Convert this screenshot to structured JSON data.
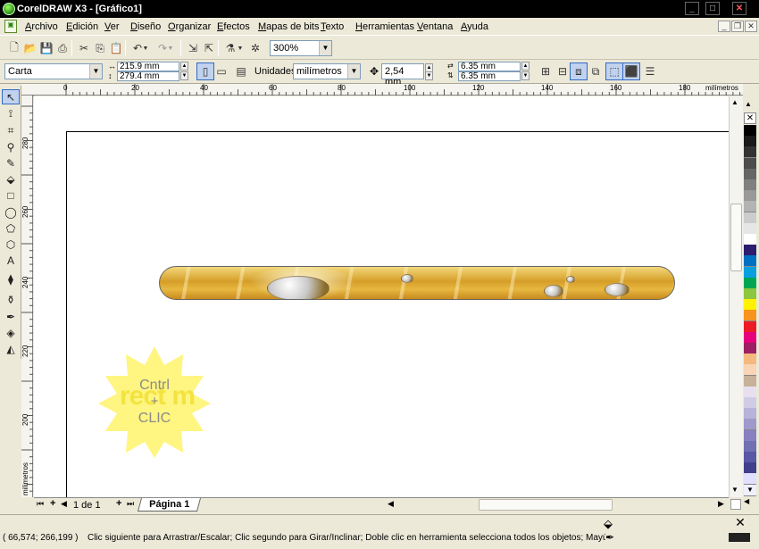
{
  "window": {
    "title": "CorelDRAW X3 - [Gráfico1]"
  },
  "menu": [
    "Archivo",
    "Edición",
    "Ver",
    "Diseño",
    "Organizar",
    "Efectos",
    "Mapas de bits",
    "Texto",
    "Herramientas",
    "Ventana",
    "Ayuda"
  ],
  "toolbar": {
    "zoom": "300%"
  },
  "property_bar": {
    "paper": "Carta",
    "width": "215.9 mm",
    "height": "279.4 mm",
    "units_label": "Unidades:",
    "units": "milímetros",
    "nudge": "2,54 mm",
    "dup_x": "6.35 mm",
    "dup_y": "6.35 mm"
  },
  "rulers": {
    "h_ticks": [
      "0",
      "20",
      "40",
      "60",
      "80",
      "100",
      "120",
      "140",
      "160",
      "180"
    ],
    "h_unit": "milímetros",
    "v_ticks": [
      "280",
      "260",
      "240",
      "220",
      "200"
    ],
    "v_unit": "milímetros"
  },
  "page_tabs": {
    "counter": "1 de 1",
    "current": "Página 1"
  },
  "status": {
    "coords": "( 66,574; 266,199 )",
    "message": "Clic siguiente para Arrastrar/Escalar; Clic segundo para Girar/Inclinar; Doble clic en herramienta selecciona todos los objetos; Mayús+clic selec..."
  },
  "overlay": {
    "line1": "Cntrl",
    "line2": "+",
    "line3": "CLIC",
    "bg_text": "rect m"
  },
  "palette": [
    "#000000",
    "#1a1a1a",
    "#333333",
    "#4d4d4d",
    "#666666",
    "#808080",
    "#999999",
    "#b3b3b3",
    "#cccccc",
    "#e6e6e6",
    "#ffffff",
    "#2e1d6e",
    "#0070c0",
    "#0aa0e0",
    "#00a651",
    "#8dc63f",
    "#fff200",
    "#f7941d",
    "#ed1c24",
    "#e6007e",
    "#9e1f63",
    "#f5b87f",
    "#f9d4b5",
    "#c7b299",
    "#e8e0f0",
    "#d0cce6",
    "#b8b3d9",
    "#a09acc",
    "#8880bf",
    "#7070b2",
    "#5858a5",
    "#40408c",
    "#e0e0ff",
    "#f0f0ff"
  ],
  "colors": {
    "accent": "#316ac5",
    "strip": "#d59d28",
    "burst": "#fff36b"
  }
}
